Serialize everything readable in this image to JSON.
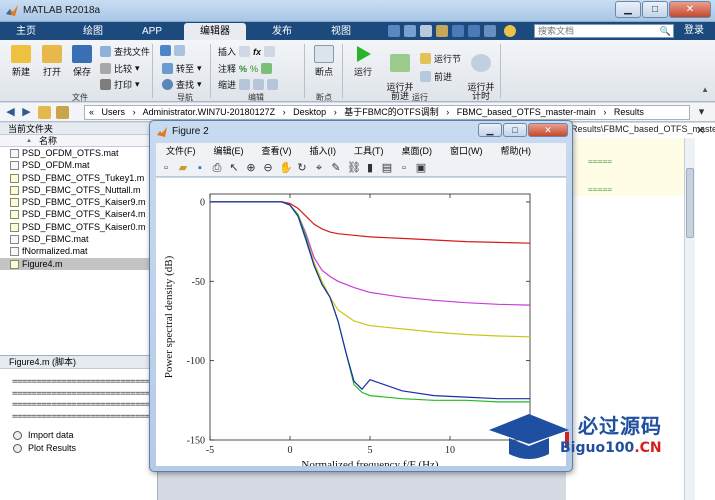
{
  "window": {
    "title": "MATLAB R2018a"
  },
  "ribbon": {
    "tabs": [
      "主页",
      "绘图",
      "APP",
      "编辑器",
      "发布",
      "视图"
    ],
    "active_tab": "编辑器",
    "search_placeholder": "搜索文档",
    "login": "登录",
    "file_group": {
      "label": "文件",
      "new": "新建",
      "open": "打开",
      "save": "保存",
      "find_files": "查找文件",
      "compare": "比较",
      "print": "打印"
    },
    "nav_group": {
      "label": "导航",
      "goto": "转至",
      "find": "查找"
    },
    "edit_group": {
      "label": "编辑",
      "insert": "插入",
      "comment": "注释",
      "indent": "缩进",
      "fx": "fx"
    },
    "breakpoint_group": {
      "label": "断点",
      "breakpoints": "断点"
    },
    "run_group": {
      "label": "运行",
      "run": "运行",
      "run_advance": "运行并\n前进",
      "run_section": "运行节",
      "advance": "前进",
      "run_time": "运行并\n计时"
    }
  },
  "address": {
    "crumbs": [
      "«",
      "Users",
      "›",
      "Administrator.WIN7U-20180127Z",
      "›",
      "Desktop",
      "›",
      "基于FBMC的OTFS调制",
      "›",
      "FBMC_based_OTFS_master-main",
      "›",
      "Results"
    ]
  },
  "current_folder": {
    "title": "当前文件夹",
    "column": "名称",
    "files": [
      "PSD_OFDM_OTFS.mat",
      "PSD_OFDM.mat",
      "PSD_FBMC_OTFS_Tukey1.m",
      "PSD_FBMC_OTFS_Nuttall.m",
      "PSD_FBMC_OTFS_Kaiser9.m",
      "PSD_FBMC_OTFS_Kaiser4.m",
      "PSD_FBMC_OTFS_Kaiser0.m",
      "PSD_FBMC.mat",
      "fNormalized.mat",
      "Figure4.m"
    ],
    "selected": "Figure4.m"
  },
  "details": {
    "title": "Figure4.m  (脚本)",
    "lines": [
      "==============================",
      "==============================",
      "==============================",
      "=============================="
    ],
    "sections": [
      "Import data",
      "Plot Results"
    ]
  },
  "editor": {
    "tab": "Results\\FBMC_based_OTFS_master-..."
  },
  "figure": {
    "title": "Figure 2",
    "menu": [
      "文件(F)",
      "编辑(E)",
      "查看(V)",
      "插入(I)",
      "工具(T)",
      "桌面(D)",
      "窗口(W)",
      "帮助(H)"
    ]
  },
  "chart_data": {
    "type": "line",
    "title": "",
    "xlabel": "Normalized frequency f/F (Hz)",
    "ylabel": "Power spectral density (dB)",
    "xlim": [
      -5,
      15
    ],
    "ylim": [
      -150,
      5
    ],
    "xticks": [
      -5,
      0,
      5,
      10
    ],
    "yticks": [
      0,
      -50,
      -100,
      -150
    ],
    "series": [
      {
        "color": "#d61a1a",
        "x": [
          -5,
          -2,
          -0.5,
          0,
          0.5,
          1,
          1.5,
          2,
          2.5,
          3,
          4,
          5,
          7,
          9,
          11,
          13,
          15
        ],
        "y": [
          0,
          0,
          0,
          -1,
          -4,
          -9,
          -14,
          -17,
          -19,
          -20,
          -21,
          -22,
          -23,
          -24,
          -25,
          -25.5,
          -26
        ]
      },
      {
        "color": "#c83cd8",
        "x": [
          -5,
          -2,
          -0.5,
          0,
          0.5,
          1,
          1.5,
          2,
          2.5,
          3,
          4,
          5,
          7,
          9,
          11,
          13,
          15
        ],
        "y": [
          0,
          0,
          0,
          -2,
          -8,
          -20,
          -35,
          -43,
          -47,
          -50,
          -54,
          -57,
          -60,
          -62,
          -63.5,
          -64.5,
          -65
        ]
      },
      {
        "color": "#c8c81a",
        "x": [
          -5,
          -2,
          -0.5,
          0,
          0.5,
          1,
          1.5,
          2,
          2.5,
          3,
          4,
          5,
          7,
          9,
          11,
          13,
          15
        ],
        "y": [
          0,
          0,
          0,
          -2,
          -8,
          -22,
          -38,
          -50,
          -60,
          -68,
          -75,
          -78,
          -80,
          -82,
          -83.5,
          -84.5,
          -85
        ]
      },
      {
        "color": "#22bb22",
        "x": [
          -5,
          -2,
          -0.5,
          0,
          0.5,
          1,
          1.5,
          2,
          2.5,
          3,
          3.5,
          4,
          4.5,
          5,
          7,
          9,
          11,
          13,
          15
        ],
        "y": [
          0,
          0,
          0,
          -2,
          -8,
          -22,
          -40,
          -52,
          -60,
          -75,
          -95,
          -115,
          -120,
          -122,
          -124,
          -125,
          -125,
          -126,
          -126
        ]
      },
      {
        "color": "#1a2ea8",
        "x": [
          -5,
          -2,
          -0.5,
          0,
          0.5,
          1,
          1.5,
          2,
          2.5,
          3,
          3.5,
          4,
          4.5,
          5,
          7,
          9,
          11,
          13,
          15
        ],
        "y": [
          0,
          0,
          0,
          -2,
          -9,
          -24,
          -40,
          -52,
          -60,
          -75,
          -95,
          -113,
          -118,
          -112,
          -119,
          -122,
          -123,
          -124,
          -124
        ]
      }
    ]
  },
  "watermark": {
    "line1": "必过源码",
    "line2a": "Biguo100",
    "line2b": ".CN"
  }
}
